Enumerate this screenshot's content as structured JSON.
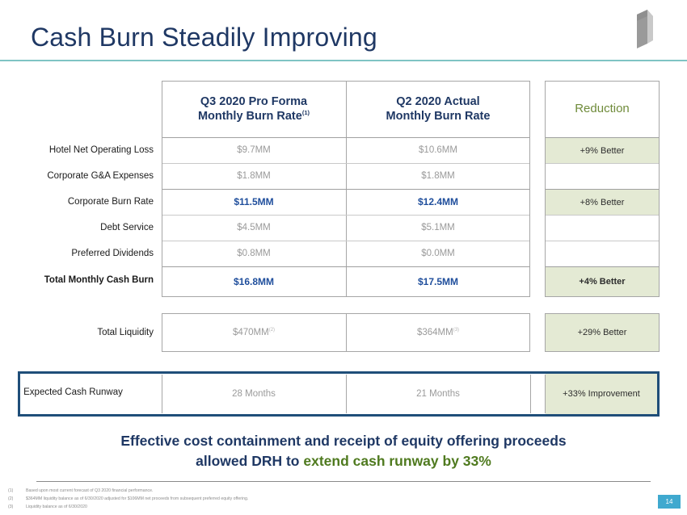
{
  "header": {
    "title": "Cash Burn Steadily Improving",
    "logo_name": "company-logo"
  },
  "table": {
    "columns": [
      {
        "id": "q3",
        "line1": "Q3 2020 Pro Forma",
        "line2": "Monthly Burn Rate",
        "footnote_marker": "(1)"
      },
      {
        "id": "q2",
        "line1": "Q2 2020 Actual",
        "line2": "Monthly Burn Rate",
        "footnote_marker": ""
      },
      {
        "id": "reduction",
        "line1": "Reduction",
        "line2": "",
        "footnote_marker": ""
      }
    ],
    "rows": [
      {
        "label": "Hotel Net Operating Loss",
        "bold": false,
        "q3": "$9.7MM",
        "q2": "$10.6MM",
        "reduction": "+9% Better",
        "reduction_highlight": true
      },
      {
        "label": "Corporate G&A Expenses",
        "bold": false,
        "q3": "$1.8MM",
        "q2": "$1.8MM",
        "reduction": "",
        "reduction_highlight": false
      },
      {
        "label": "Corporate Burn Rate",
        "bold": false,
        "q3": "$11.5MM",
        "q2": "$12.4MM",
        "reduction": "+8% Better",
        "reduction_highlight": true
      },
      {
        "label": "Debt Service",
        "bold": false,
        "q3": "$4.5MM",
        "q2": "$5.1MM",
        "reduction": "",
        "reduction_highlight": false
      },
      {
        "label": "Preferred Dividends",
        "bold": false,
        "q3": "$0.8MM",
        "q2": "$0.0MM",
        "reduction": "",
        "reduction_highlight": false
      },
      {
        "label": "Total Monthly Cash Burn",
        "bold": true,
        "q3": "$16.8MM",
        "q2": "$17.5MM",
        "reduction": "+4% Better",
        "reduction_highlight": true
      }
    ]
  },
  "liquidity": {
    "label": "Total Liquidity",
    "q3": "$470MM",
    "q3_marker": "(2)",
    "q2": "$364MM",
    "q2_marker": "(3)",
    "reduction": "+29% Better"
  },
  "runway": {
    "label": "Expected Cash Runway",
    "q3": "28 Months",
    "q2": "21 Months",
    "reduction": "+33% Improvement"
  },
  "tagline": {
    "line1": "Effective cost containment and receipt of equity offering proceeds",
    "line2_prefix": "allowed DRH to ",
    "line2_green": "extend cash runway by 33%"
  },
  "footnotes": [
    {
      "num": "(1)",
      "text": "Based upon most current forecast of Q3 2020 financial performance."
    },
    {
      "num": "(2)",
      "text": "$364MM liquidity balance as of 6/30/2020 adjusted for $106MM net proceeds from subsequent preferred equity offering."
    },
    {
      "num": "(3)",
      "text": "Liquidity balance as of 6/30/2020"
    }
  ],
  "page_number": "14"
}
